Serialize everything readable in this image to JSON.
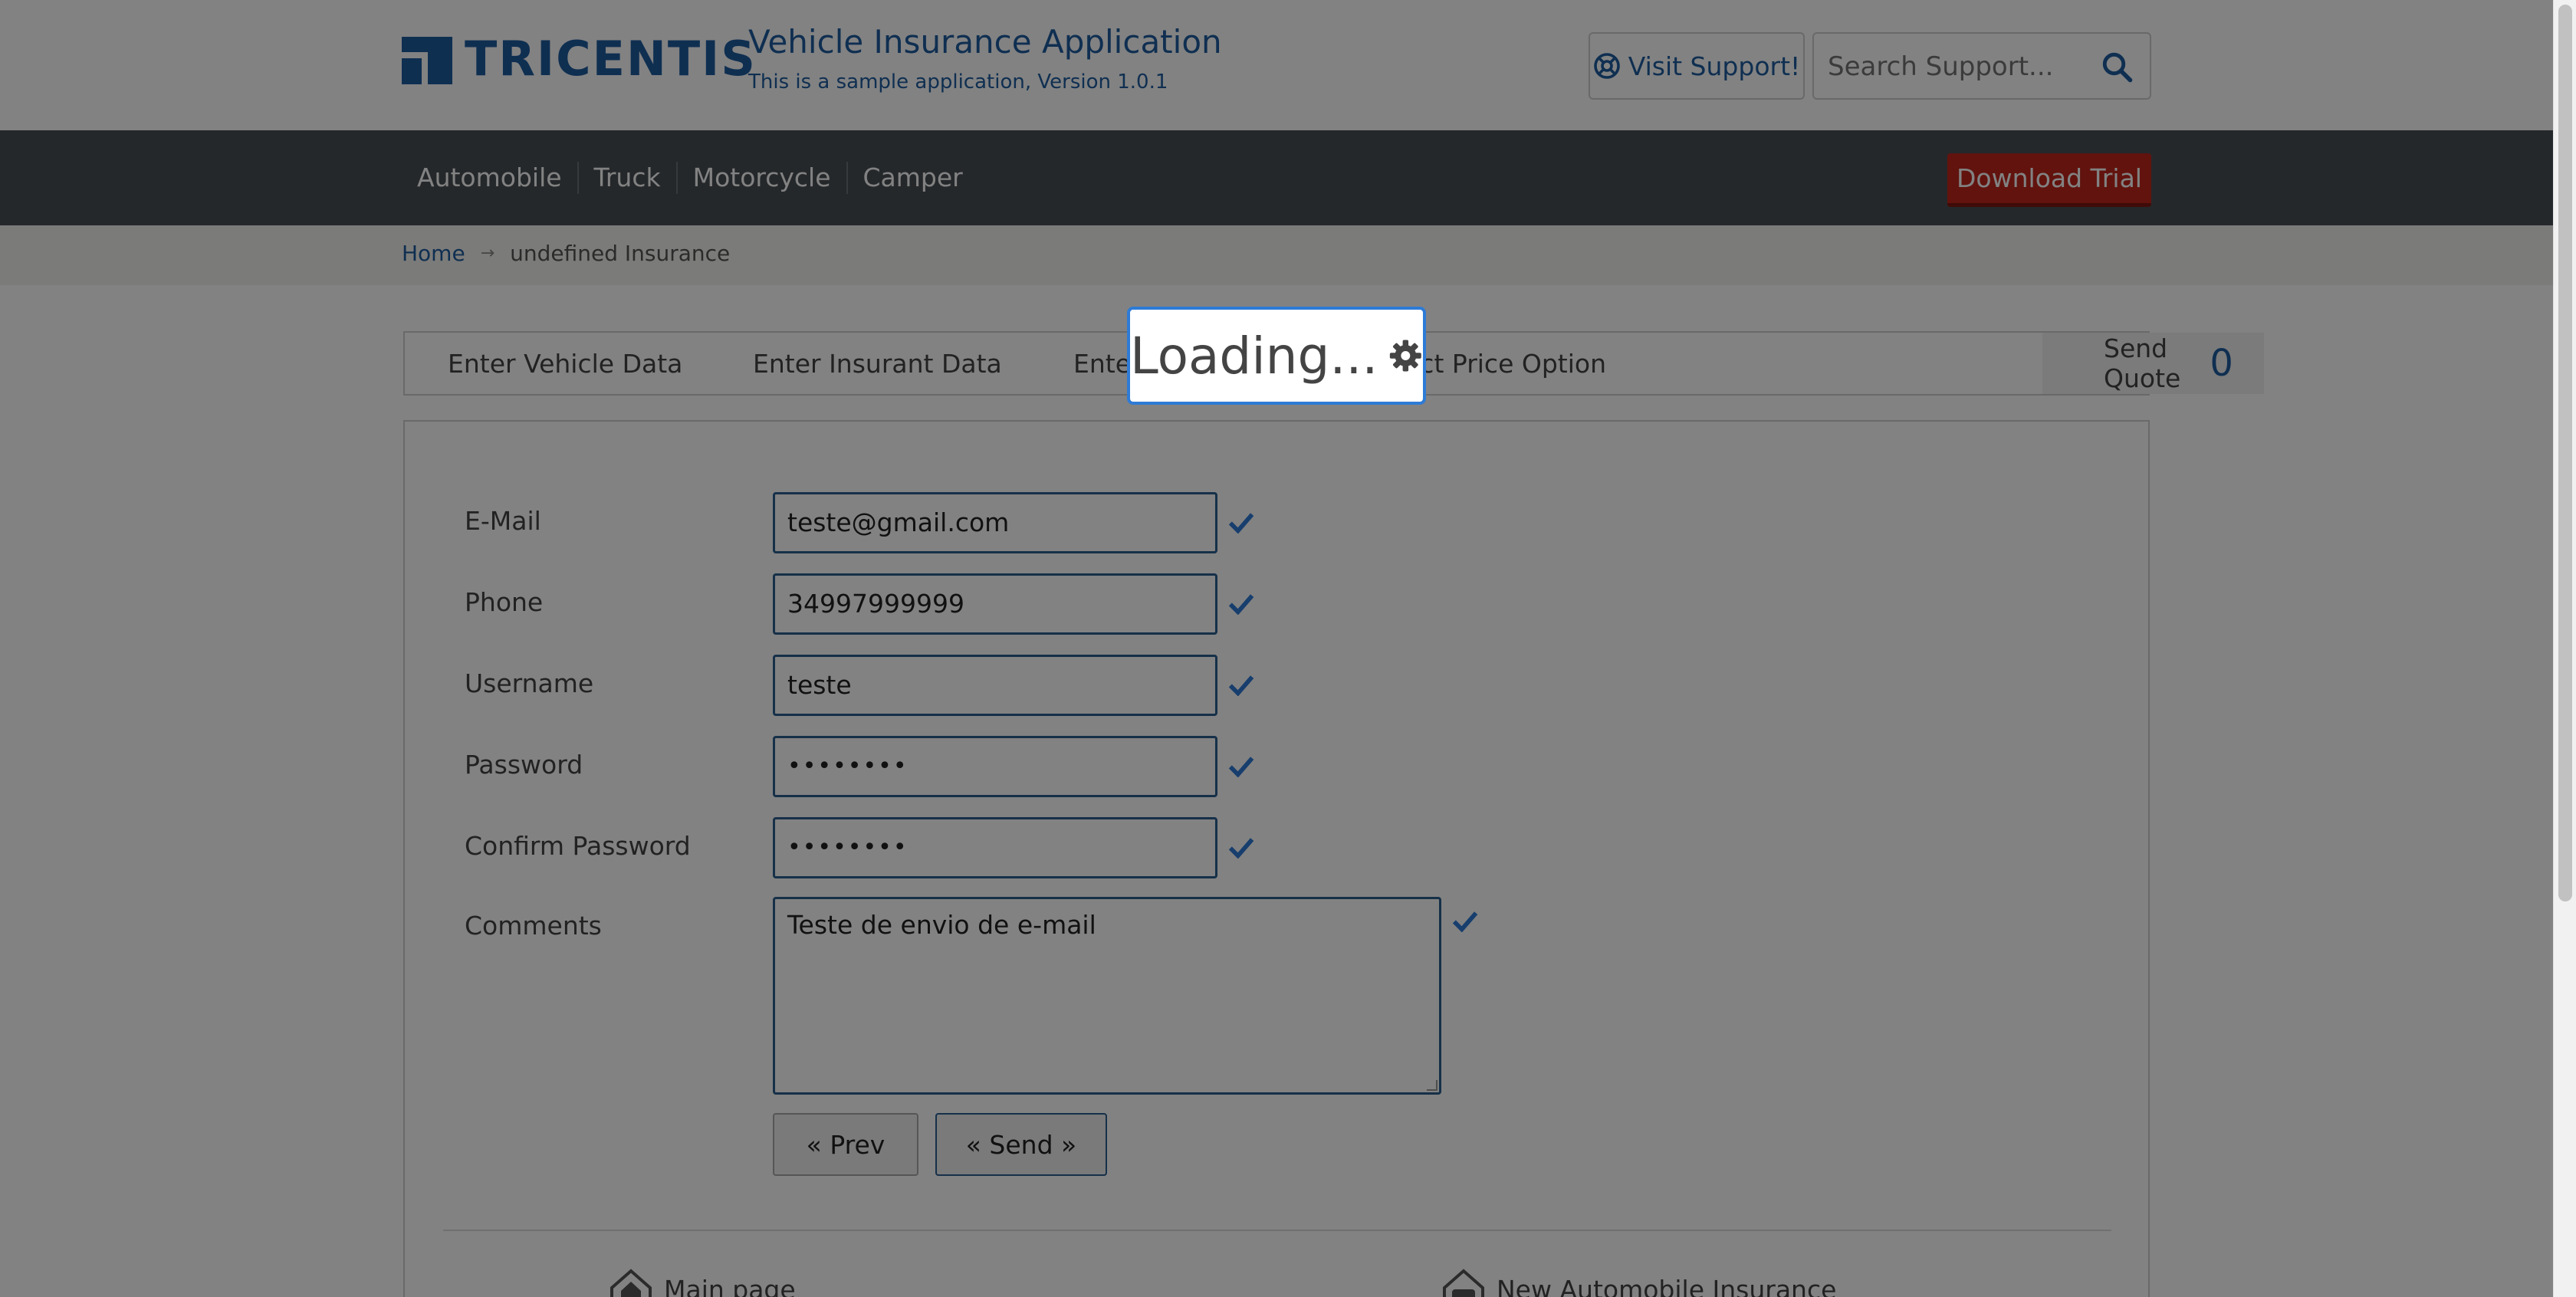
{
  "header": {
    "logo_text": "TRICENTIS",
    "app_title": "Vehicle Insurance Application",
    "app_subtitle": "This is a sample application, Version 1.0.1",
    "support_button": "Visit Support!",
    "search_placeholder": "Search Support..."
  },
  "nav": {
    "items": [
      "Automobile",
      "Truck",
      "Motorcycle",
      "Camper"
    ],
    "download_button": "Download Trial"
  },
  "breadcrumb": {
    "home": "Home",
    "separator": "→",
    "current": "undefined Insurance"
  },
  "tabs": {
    "items": [
      "Enter Vehicle Data",
      "Enter Insurant Data",
      "Enter",
      "ect Price Option",
      "Send Quote"
    ],
    "send_quote_count": "0"
  },
  "form": {
    "email": {
      "label": "E-Mail",
      "value": "teste@gmail.com"
    },
    "phone": {
      "label": "Phone",
      "value": "34997999999"
    },
    "username": {
      "label": "Username",
      "value": "teste"
    },
    "password": {
      "label": "Password",
      "value": "••••••••"
    },
    "confirm_password": {
      "label": "Confirm Password",
      "value": "••••••••"
    },
    "comments": {
      "label": "Comments",
      "value": "Teste de envio de e-mail"
    },
    "prev_button": "« Prev",
    "send_button": "« Send »"
  },
  "footer": {
    "main_page": "Main page",
    "new_insurance": "New Automobile Insurance"
  },
  "overlay": {
    "loading_text": "Loading..."
  },
  "colors": {
    "brand": "#1f5ca0",
    "nav_bg": "#4a5055",
    "download": "#c0271d",
    "check": "#2e7bd6"
  }
}
